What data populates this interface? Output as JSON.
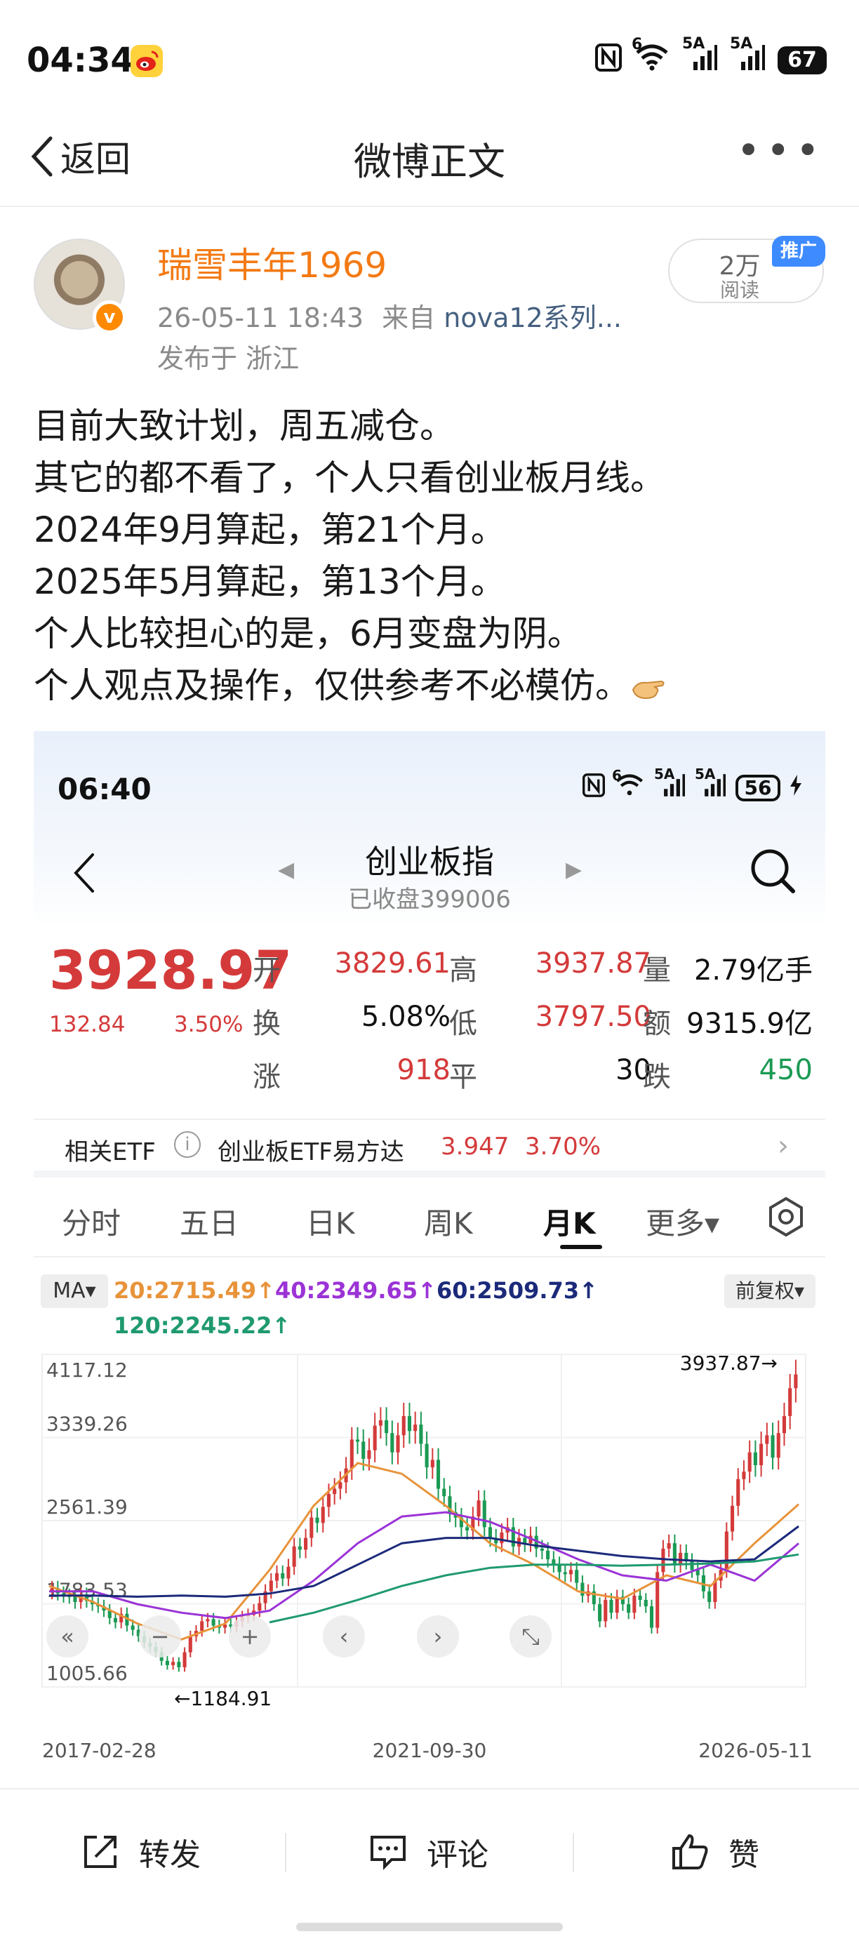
{
  "status_bar": {
    "time": "04:34",
    "net1": "6",
    "net2": "5A",
    "net3": "5A",
    "battery": "67"
  },
  "nav": {
    "back_label": "返回",
    "title": "微博正文",
    "more": "•••"
  },
  "post": {
    "author": "瑞雪丰年1969",
    "time": "26-05-11 18:43",
    "from_label": "来自",
    "source": "nova12系列...",
    "location": "发布于 浙江",
    "reads_count": "2万",
    "reads_label": "阅读",
    "promo_tag": "推广",
    "lines": [
      "目前大致计划，周五减仓。",
      "其它的都不看了，个人只看创业板月线。",
      "2024年9月算起，第21个月。",
      "2025年5月算起，第13个月。",
      "个人比较担心的是，6月变盘为阴。",
      "个人观点及操作，仅供参考不必模仿。"
    ]
  },
  "embedded": {
    "status_time": "06:40",
    "status_net1": "6",
    "status_net2": "5A",
    "status_net3": "5A",
    "status_battery": "56",
    "title": "创业板指",
    "subtitle": "已收盘399006",
    "price": "3928.97",
    "change": "132.84",
    "change_pct": "3.50%",
    "quote": {
      "open_label": "开",
      "open": "3829.61",
      "high_label": "高",
      "high": "3937.87",
      "volume_label": "量",
      "volume": "2.79亿手",
      "turnover_label": "换",
      "turnover": "5.08%",
      "low_label": "低",
      "low": "3797.50",
      "amount_label": "额",
      "amount": "9315.9亿",
      "up_label": "涨",
      "up": "918",
      "flat_label": "平",
      "flat": "30",
      "down_label": "跌",
      "down": "450"
    },
    "etf": {
      "label": "相关ETF",
      "info": "i",
      "name": "创业板ETF易方达",
      "value": "3.947",
      "pct": "3.70%"
    },
    "tabs": [
      "分时",
      "五日",
      "日K",
      "周K",
      "月K",
      "更多▾"
    ],
    "ma_button": "MA▾",
    "ma": {
      "ma20": "20:2715.49↑",
      "ma40": "40:2349.65↑",
      "ma60": "60:2509.73↑",
      "ma120": "120:2245.22↑"
    },
    "adjust_button": "前复权▾",
    "chart_controls": [
      "«",
      "−",
      "+",
      "‹",
      "›",
      "⤡"
    ]
  },
  "colors": {
    "up": "#d43a3a",
    "down": "#1b9a54",
    "ma20": "#e8933a",
    "ma40": "#9b33d6",
    "ma60": "#1c2a7a",
    "ma120": "#1f9a6e",
    "username": "#f37a14"
  },
  "chart_data": {
    "type": "candlestick",
    "title": "创业板指 月K",
    "ylabels": [
      "4117.12",
      "3339.26",
      "2561.39",
      "1783.53",
      "1005.66"
    ],
    "ylim": [
      1005.66,
      4117.12
    ],
    "xlabels": [
      "2017-02-28",
      "2021-09-30",
      "2026-05-11"
    ],
    "annotation_high": "3937.87→",
    "annotation_low": "←1184.91",
    "closes": [
      1930,
      1880,
      1860,
      1850,
      1800,
      1870,
      1810,
      1780,
      1760,
      1720,
      1650,
      1610,
      1690,
      1580,
      1540,
      1480,
      1420,
      1380,
      1330,
      1250,
      1210,
      1240,
      1190,
      1330,
      1480,
      1530,
      1620,
      1640,
      1580,
      1560,
      1590,
      1570,
      1620,
      1660,
      1680,
      1720,
      1790,
      1900,
      2000,
      2070,
      2020,
      2130,
      2320,
      2290,
      2400,
      2590,
      2540,
      2690,
      2810,
      2860,
      2920,
      3050,
      3320,
      3300,
      3140,
      3220,
      3450,
      3500,
      3380,
      3200,
      3360,
      3540,
      3400,
      3460,
      3280,
      3060,
      3130,
      2860,
      2790,
      2640,
      2590,
      2500,
      2470,
      2600,
      2750,
      2500,
      2400,
      2350,
      2450,
      2500,
      2320,
      2400,
      2350,
      2420,
      2300,
      2280,
      2200,
      2150,
      2080,
      2060,
      2100,
      1980,
      1860,
      1900,
      1780,
      1620,
      1820,
      1700,
      1850,
      1780,
      1700,
      1860,
      1820,
      1760,
      1560,
      2080,
      2300,
      2350,
      2150,
      2260,
      2180,
      2100,
      2050,
      1900,
      1800,
      2000,
      2100,
      2460,
      2700,
      2950,
      3020,
      3200,
      3080,
      3280,
      3360,
      3150,
      3380,
      3540,
      3800,
      3929
    ],
    "series": [
      {
        "name": "MA20",
        "values": [
          1950,
          1800,
          1600,
          1450,
          1600,
          2100,
          2700,
          3100,
          3000,
          2700,
          2350,
          2150,
          1900,
          1830,
          2050,
          1950,
          2350,
          2715
        ]
      },
      {
        "name": "MA40",
        "values": [
          1900,
          1900,
          1780,
          1700,
          1650,
          1720,
          2000,
          2350,
          2600,
          2640,
          2550,
          2380,
          2200,
          2050,
          2000,
          2150,
          2000,
          2349
        ]
      },
      {
        "name": "MA60",
        "values": [
          1860,
          1860,
          1850,
          1860,
          1850,
          1880,
          1950,
          2150,
          2350,
          2400,
          2400,
          2330,
          2280,
          2230,
          2200,
          2180,
          2200,
          2509
        ]
      },
      {
        "name": "MA120",
        "values": [
          null,
          null,
          null,
          null,
          null,
          1610,
          1700,
          1820,
          1950,
          2050,
          2120,
          2150,
          2150,
          2140,
          2150,
          2160,
          2180,
          2245
        ]
      }
    ]
  },
  "actions": {
    "repost": "转发",
    "comment": "评论",
    "like": "赞"
  }
}
